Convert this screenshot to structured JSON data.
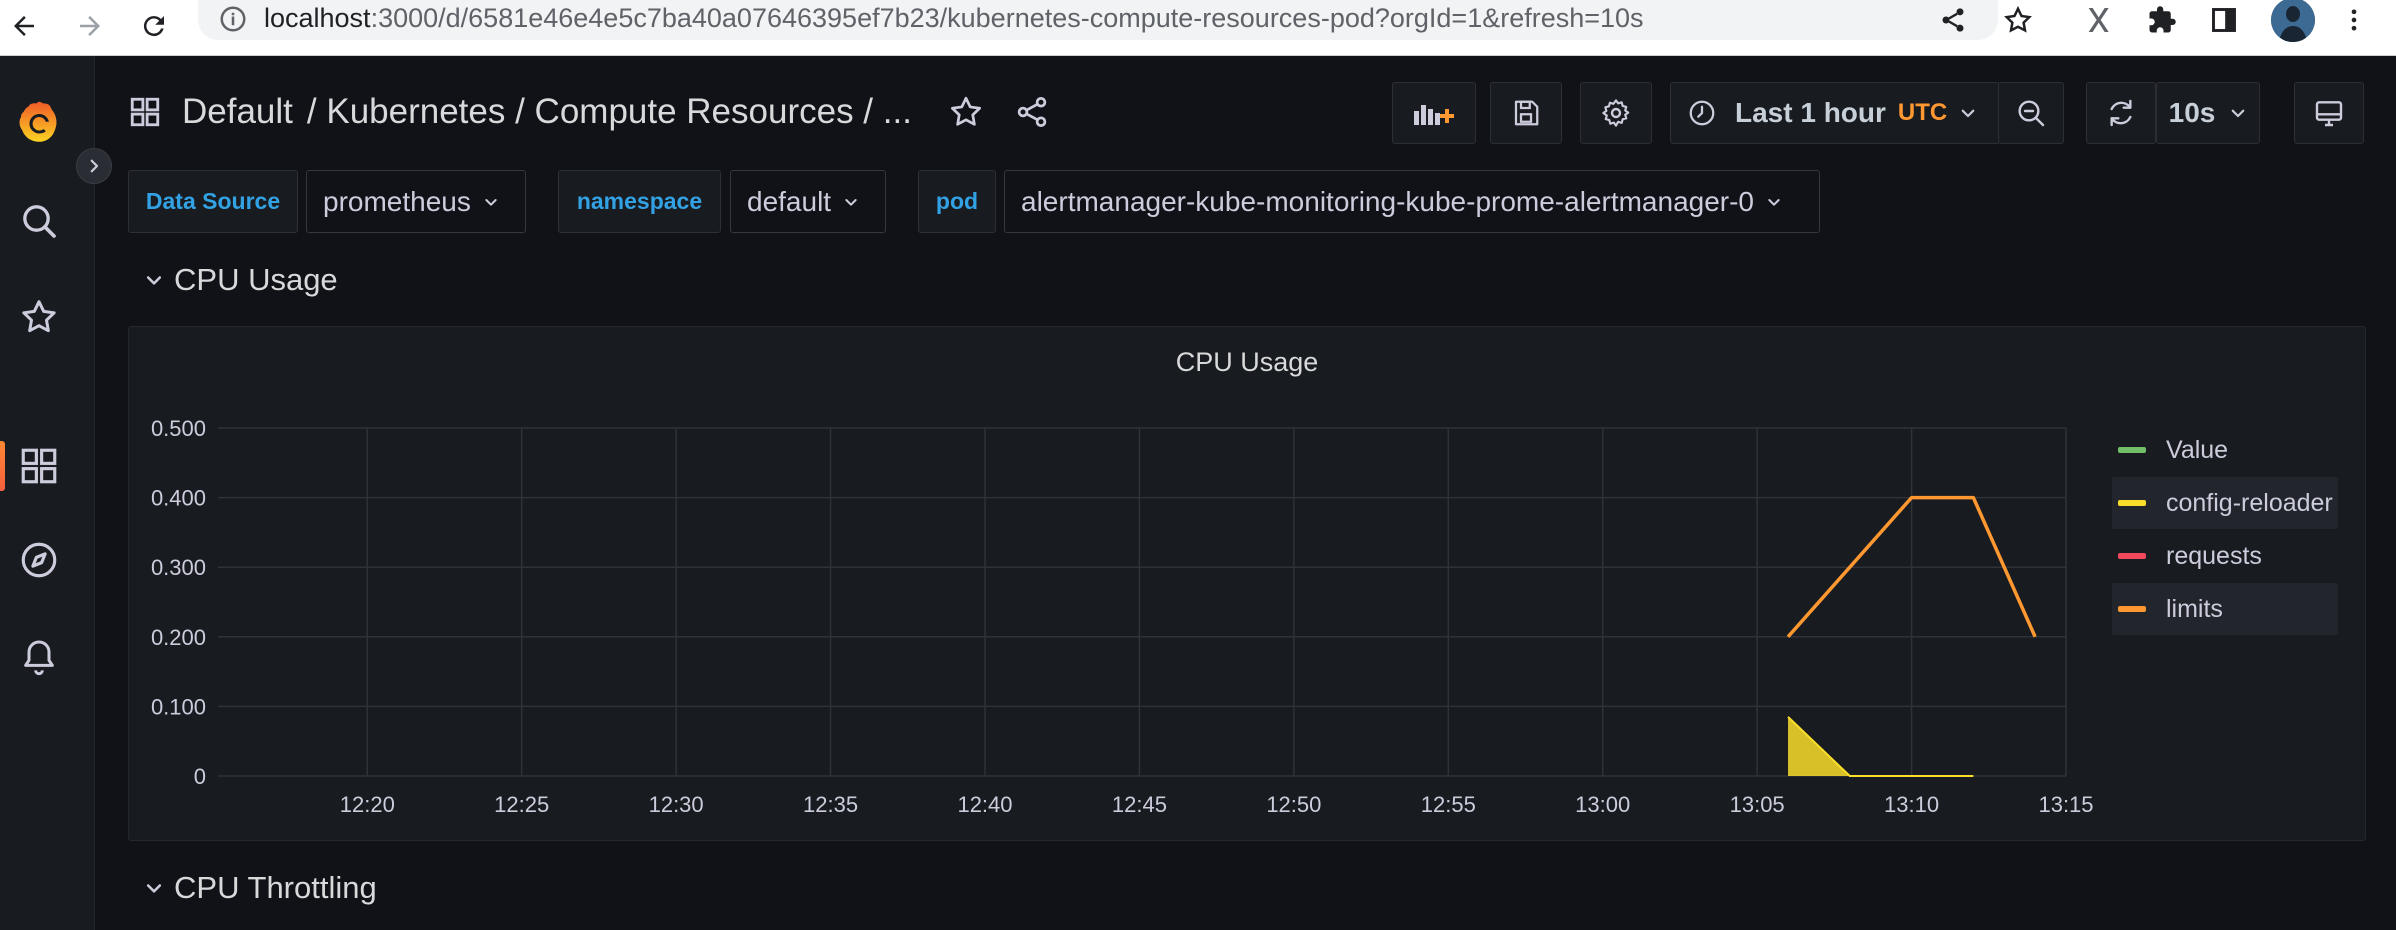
{
  "browser": {
    "url_host": "localhost",
    "url_path": ":3000/d/6581e46e4e5c7ba40a07646395ef7b23/kubernetes-compute-resources-pod?orgId=1&refresh=10s"
  },
  "header": {
    "breadcrumb_root": "Default",
    "breadcrumb_rest": "/ Kubernetes / Compute Resources / ..."
  },
  "toolbar": {
    "time_range": "Last 1 hour",
    "timezone": "UTC",
    "refresh_interval": "10s"
  },
  "variables": [
    {
      "label": "Data Source",
      "value": "prometheus"
    },
    {
      "label": "namespace",
      "value": "default"
    },
    {
      "label": "pod",
      "value": "alertmanager-kube-monitoring-kube-prome-alertmanager-0"
    }
  ],
  "rows": {
    "cpu_usage": "CPU Usage",
    "cpu_throttling": "CPU Throttling"
  },
  "colors": {
    "value": "#73bf69",
    "config_reloader": "#fade2a",
    "requests": "#f2495c",
    "limits": "#ff9830",
    "accent": "#ff7c32",
    "link_blue": "#33a2e5"
  },
  "chart_data": {
    "type": "line",
    "title": "CPU Usage",
    "x_ticks": [
      "12:20",
      "12:25",
      "12:30",
      "12:35",
      "12:40",
      "12:45",
      "12:50",
      "12:55",
      "13:00",
      "13:05",
      "13:10",
      "13:15"
    ],
    "y_ticks": [
      "0",
      "0.100",
      "0.200",
      "0.300",
      "0.400",
      "0.500"
    ],
    "ylim": [
      0,
      0.5
    ],
    "xlim": [
      "12:15:10",
      "13:15"
    ],
    "grid": true,
    "legend_position": "right",
    "series": [
      {
        "name": "Value",
        "color": "#73bf69",
        "points": []
      },
      {
        "name": "config-reloader",
        "color": "#fade2a",
        "fill": true,
        "points": [
          [
            "13:06",
            0.085
          ],
          [
            "13:08",
            0.0
          ],
          [
            "13:12",
            0.0
          ]
        ]
      },
      {
        "name": "requests",
        "color": "#f2495c",
        "points": []
      },
      {
        "name": "limits",
        "color": "#ff9830",
        "points": [
          [
            "13:06",
            0.2
          ],
          [
            "13:10",
            0.4
          ],
          [
            "13:12",
            0.4
          ],
          [
            "13:14",
            0.2
          ]
        ]
      }
    ]
  }
}
